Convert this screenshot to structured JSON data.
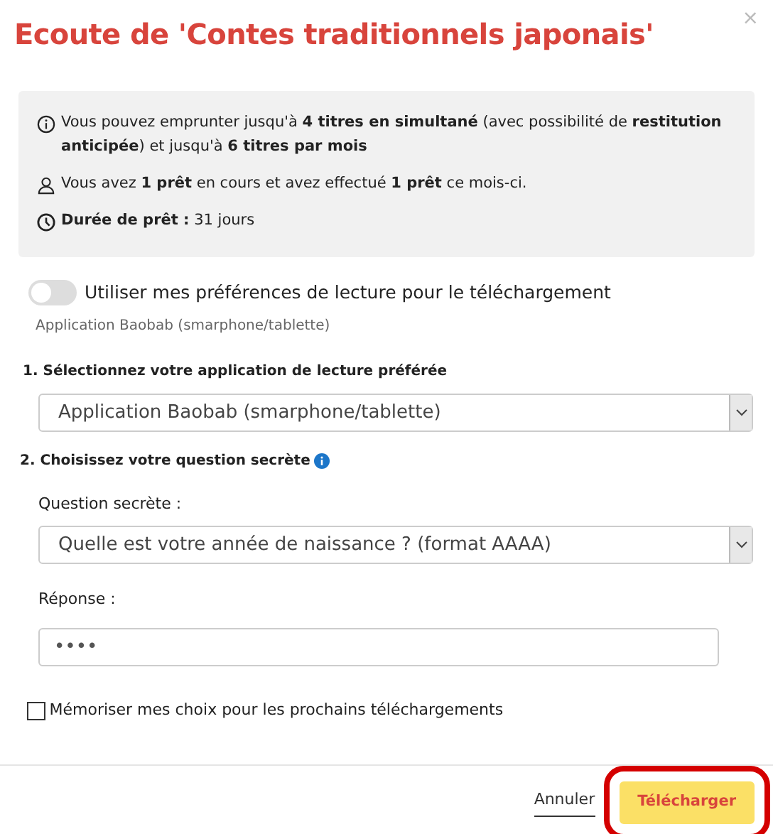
{
  "dialog": {
    "title": "Ecoute de 'Contes traditionnels japonais'",
    "close": "×"
  },
  "info": [
    {
      "kind": "info",
      "text": "Vous pouvez emprunter jusqu'à **4 titres en simultané** (avec possibilité de **restitution anticipée**) et jusqu'à **6 titres par mois**"
    },
    {
      "kind": "user",
      "text": "Vous avez **1 prêt** en cours et avez effectué **1 prêt** ce mois-ci."
    },
    {
      "kind": "clock",
      "text": "**Durée de prêt :** 31 jours"
    }
  ],
  "preferences_toggle": {
    "label": "Utiliser mes préférences de lecture pour le téléchargement",
    "on": false,
    "hint": "Application Baobab (smarphone/tablette)"
  },
  "step_1": {
    "label": "1. Sélectionnez votre application de lecture préférée",
    "value": "Application Baobab (smarphone/tablette)"
  },
  "step_2": {
    "label": "2. Choisissez votre question secrète",
    "question_label": "Question secrète :",
    "question_value": "Quelle est votre année de naissance ? (format AAAA)",
    "answer_label": "Réponse :",
    "answer_value": "••••"
  },
  "remember_checkbox": {
    "label": "Mémoriser mes choix pour les prochains téléchargements",
    "checked": false
  },
  "buttons": [
    {
      "kind": "link",
      "label": "Annuler",
      "highlighted": false
    },
    {
      "kind": "primary",
      "label": "Télécharger",
      "highlighted": true
    }
  ]
}
